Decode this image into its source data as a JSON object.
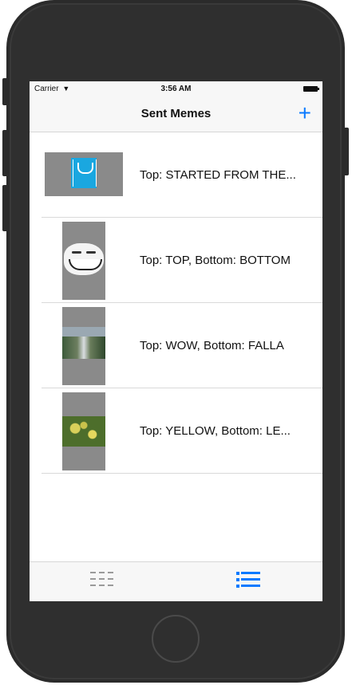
{
  "status_bar": {
    "carrier": "Carrier",
    "wifi_icon": "wifi-icon",
    "time": "3:56 AM",
    "battery_icon": "battery-icon"
  },
  "nav_bar": {
    "title": "Sent Memes",
    "add_button": "+"
  },
  "memes": [
    {
      "label": "Top: STARTED FROM THE...",
      "thumbnail": "udacity-logo-image"
    },
    {
      "label": "Top: TOP, Bottom: BOTTOM",
      "thumbnail": "troll-face-image"
    },
    {
      "label": "Top: WOW, Bottom: FALLA",
      "thumbnail": "waterfall-image"
    },
    {
      "label": "Top: YELLOW, Bottom: LE...",
      "thumbnail": "yellow-flowers-image"
    }
  ],
  "tab_bar": {
    "tabs": [
      {
        "name": "grid",
        "icon": "grid-icon",
        "selected": false
      },
      {
        "name": "list",
        "icon": "list-icon",
        "selected": true
      }
    ],
    "accent_color": "#0a7aff",
    "inactive_color": "#9a9a9a"
  }
}
